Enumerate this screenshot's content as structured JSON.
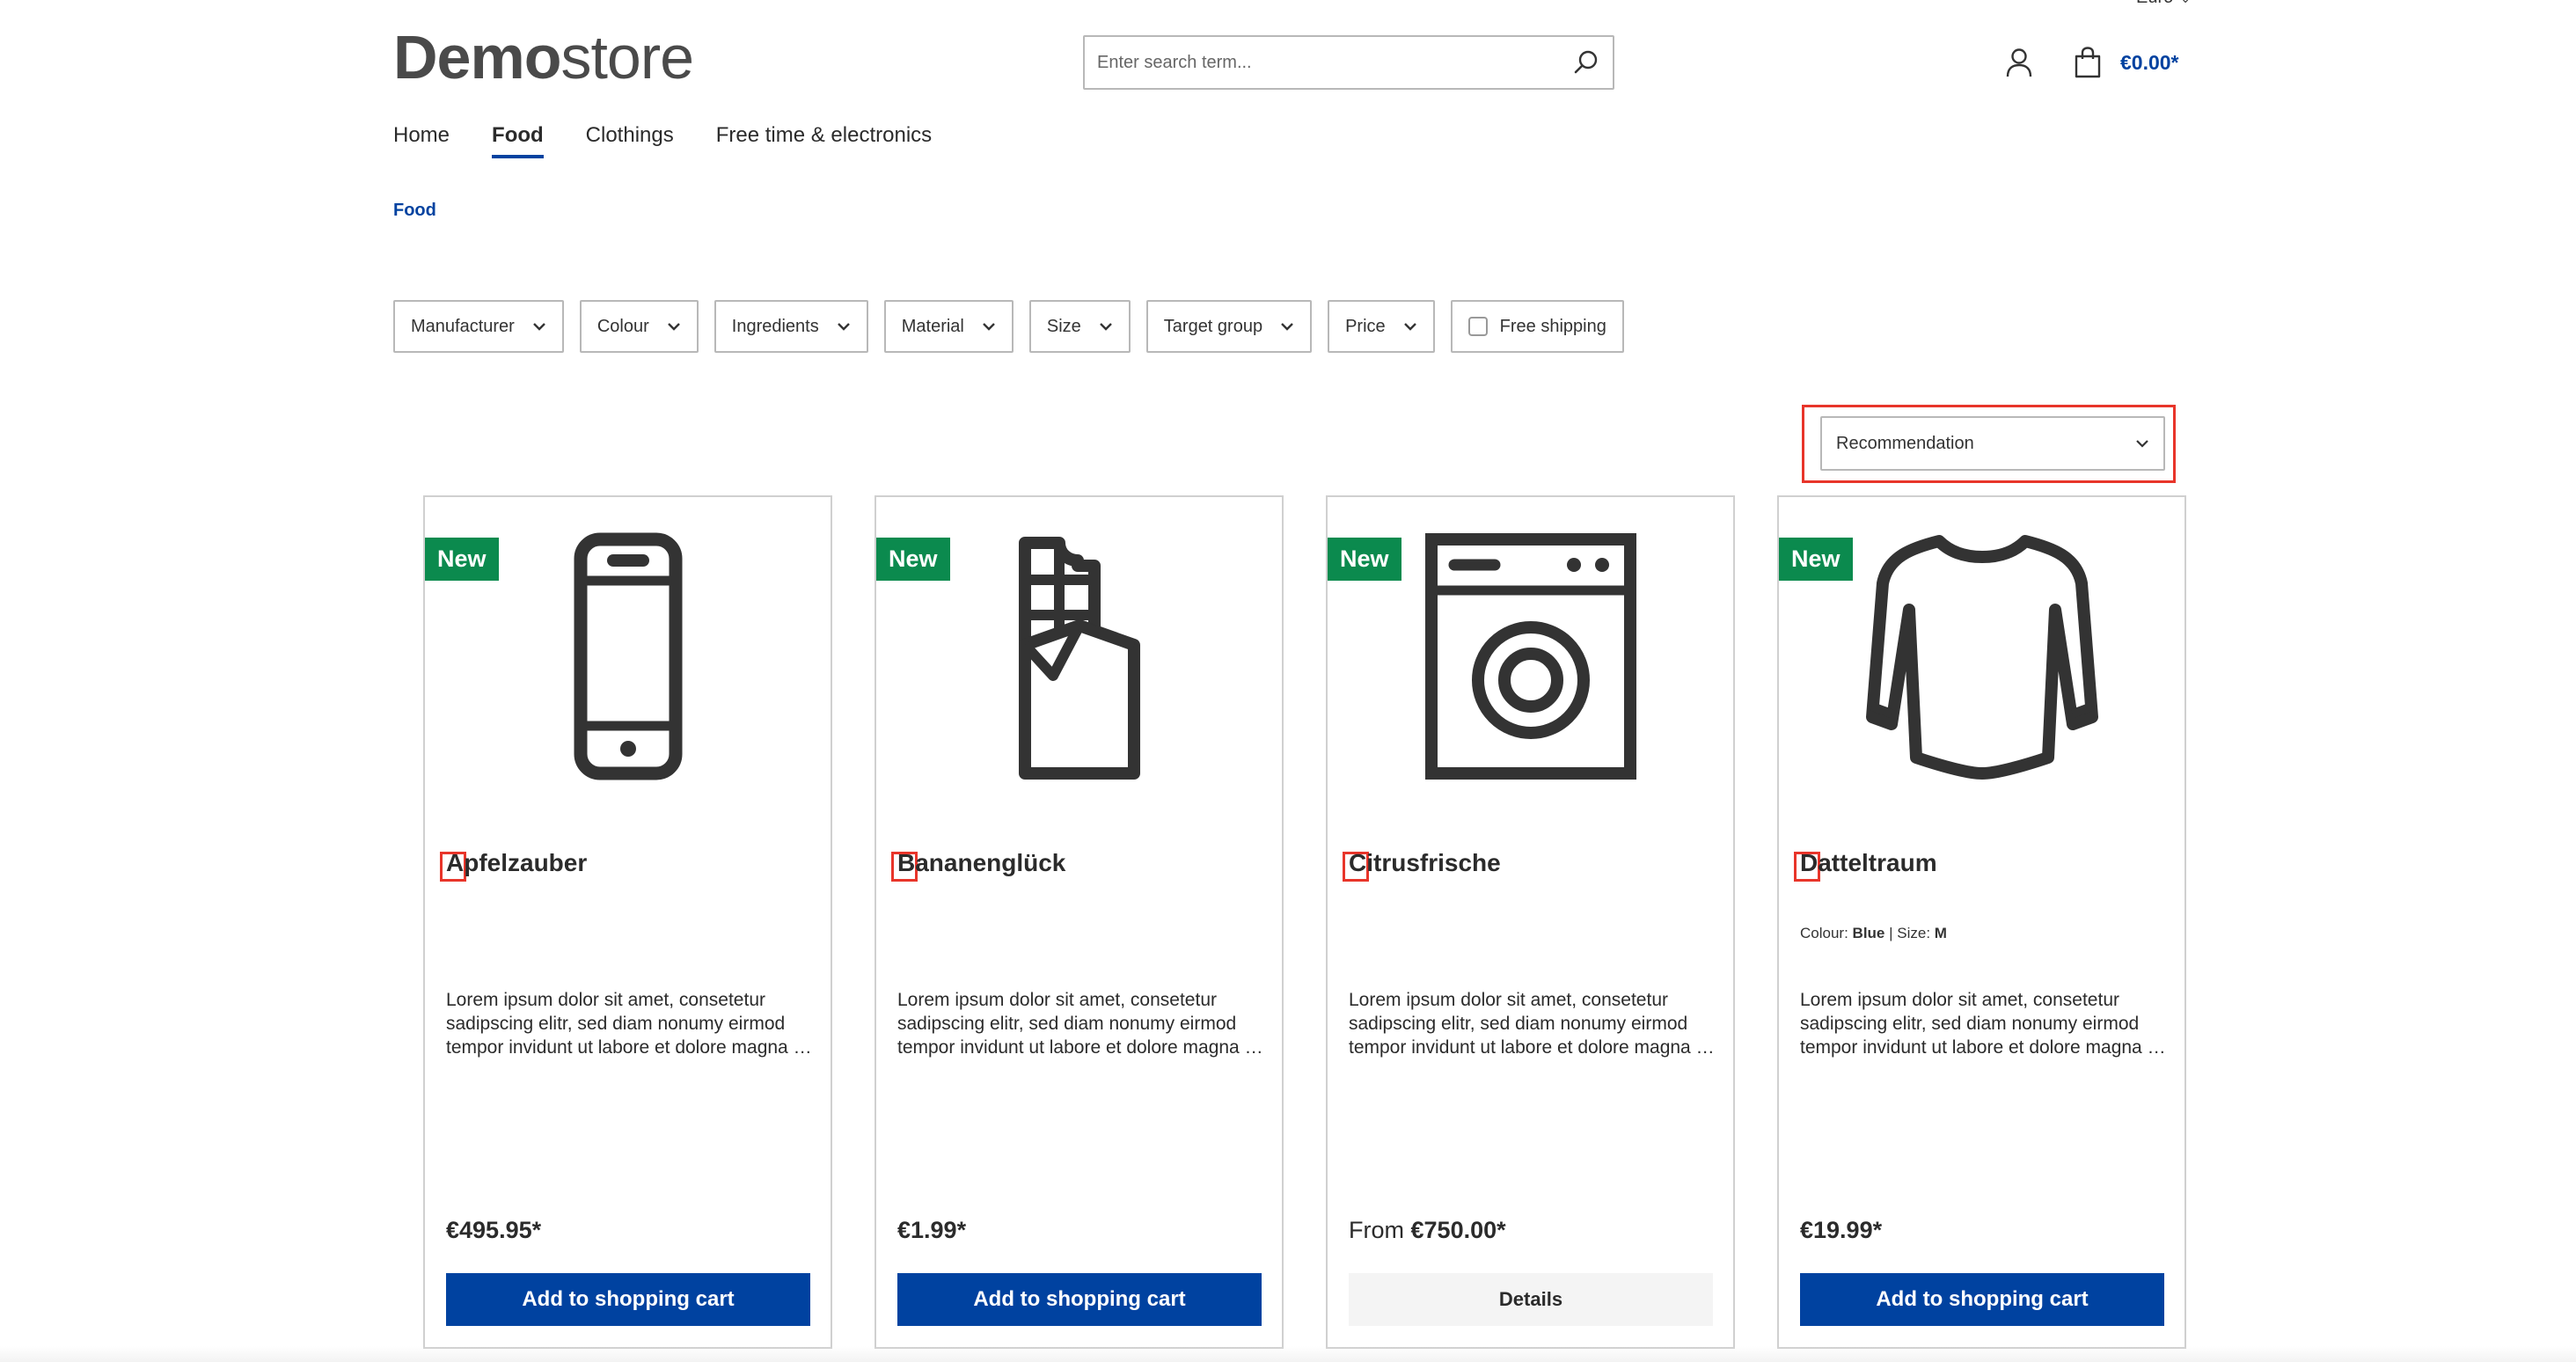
{
  "currency": {
    "label": "Euro"
  },
  "header": {
    "logo_bold": "Demo",
    "logo_light": "store",
    "search_placeholder": "Enter search term...",
    "cart_total": "€0.00*"
  },
  "nav": {
    "items": [
      {
        "label": "Home",
        "active": false
      },
      {
        "label": "Food",
        "active": true
      },
      {
        "label": "Clothings",
        "active": false
      },
      {
        "label": "Free time & electronics",
        "active": false
      }
    ]
  },
  "breadcrumb": {
    "current": "Food"
  },
  "filters": {
    "items": [
      "Manufacturer",
      "Colour",
      "Ingredients",
      "Material",
      "Size",
      "Target group",
      "Price"
    ],
    "free_shipping": "Free shipping"
  },
  "sorting": {
    "selected": "Recommendation"
  },
  "products": [
    {
      "badge": "New",
      "name": "Apfelzauber",
      "icon": "smartphone-icon",
      "description_1": "Lorem ipsum dolor sit amet, consetetur",
      "description_2": "sadipscing elitr, sed diam nonumy eirmod",
      "description_3": "tempor invidunt ut labore et dolore magna aliquyam",
      "price": "€495.95*",
      "action": "Add to shopping cart"
    },
    {
      "badge": "New",
      "name": "Bananenglück",
      "icon": "chocolate-bar-icon",
      "description_1": "Lorem ipsum dolor sit amet, consetetur",
      "description_2": "sadipscing elitr, sed diam nonumy eirmod",
      "description_3": "tempor invidunt ut labore et dolore magna aliquyam",
      "price": "€1.99*",
      "action": "Add to shopping cart"
    },
    {
      "badge": "New",
      "name": "Citrusfrische",
      "icon": "washing-machine-icon",
      "description_1": "Lorem ipsum dolor sit amet, consetetur",
      "description_2": "sadipscing elitr, sed diam nonumy eirmod",
      "description_3": "tempor invidunt ut labore et dolore magna aliquyam",
      "price_prefix": "From",
      "price": "€750.00*",
      "action": "Details"
    },
    {
      "badge": "New",
      "name": "Datteltraum",
      "icon": "sweater-icon",
      "variant_colour_label": "Colour:",
      "variant_colour": "Blue",
      "variant_size_label": "| Size:",
      "variant_size": "M",
      "description_1": "Lorem ipsum dolor sit amet, consetetur",
      "description_2": "sadipscing elitr, sed diam nonumy eirmod",
      "description_3": "tempor invidunt ut labore et dolore magna aliquyam",
      "price": "€19.99*",
      "action": "Add to shopping cart"
    }
  ],
  "colors": {
    "primary": "#0042a0",
    "badge_new": "#0b8a4e",
    "highlight": "#e8352a"
  }
}
